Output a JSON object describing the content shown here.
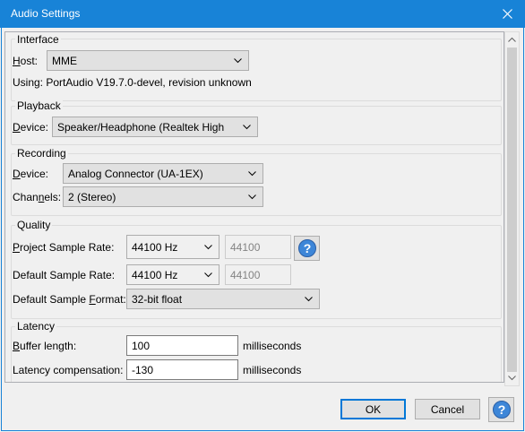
{
  "window": {
    "title": "Audio Settings",
    "close_icon": "close-icon"
  },
  "interface": {
    "label": "Interface",
    "host_label_u": "H",
    "host_label_rest": "ost:",
    "host_value": "MME",
    "using_text": "Using: PortAudio V19.7.0-devel, revision unknown"
  },
  "playback": {
    "label": "Playback",
    "device_label_u": "D",
    "device_label_rest": "evice:",
    "device_value": "Speaker/Headphone (Realtek High"
  },
  "recording": {
    "label": "Recording",
    "device_label_u": "D",
    "device_label_rest": "evice:",
    "device_value": "Analog Connector (UA-1EX)",
    "channels_label_pre": "Chan",
    "channels_label_u": "n",
    "channels_label_post": "els:",
    "channels_value": "2 (Stereo)"
  },
  "quality": {
    "label": "Quality",
    "project_rate_label_u": "P",
    "project_rate_label_rest": "roject Sample Rate:",
    "project_rate_value": "44100 Hz",
    "project_rate_text": "44100",
    "default_rate_label": "Default Sample Rate:",
    "default_rate_value": "44100 Hz",
    "default_rate_text": "44100",
    "format_label_pre": "Default Sample ",
    "format_label_u": "F",
    "format_label_post": "ormat:",
    "format_value": "32-bit float"
  },
  "latency": {
    "label": "Latency",
    "buffer_label_u": "B",
    "buffer_label_rest": "uffer length:",
    "buffer_value": "100",
    "buffer_unit": "milliseconds",
    "comp_label_pre": "Latency compensation:",
    "comp_value": "-130",
    "comp_unit": "milliseconds"
  },
  "buttons": {
    "ok": "OK",
    "cancel": "Cancel",
    "help_glyph": "?"
  }
}
